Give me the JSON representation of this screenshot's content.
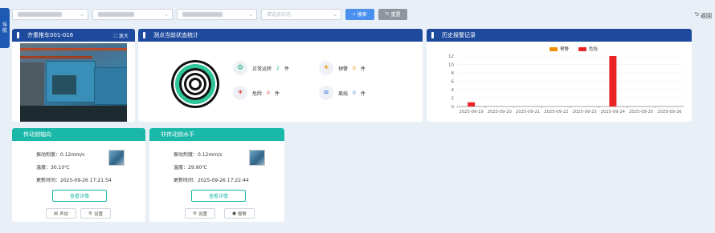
{
  "nav": {
    "label": "导航"
  },
  "filters": {
    "status_placeholder": "请选择状态",
    "search_label": "搜索",
    "reset_label": "重置"
  },
  "back_label": "返回",
  "device": {
    "title": "齐重推车001-016",
    "zoom_label": "放大"
  },
  "status_panel": {
    "title": "测点当前状态统计",
    "items": [
      {
        "label": "正常运转",
        "count": "2",
        "unit": "件"
      },
      {
        "label": "预警",
        "count": "0",
        "unit": "件"
      },
      {
        "label": "危险",
        "count": "0",
        "unit": "件"
      },
      {
        "label": "离线",
        "count": "0",
        "unit": "件"
      }
    ]
  },
  "alarm_panel": {
    "title": "历史报警记录"
  },
  "chart_data": {
    "type": "bar",
    "title": "",
    "categories": [
      "2025-09-19",
      "2025-09-20",
      "2025-09-21",
      "2025-09-22",
      "2025-09-23",
      "2025-09-24",
      "2025-09-25",
      "2025-09-26"
    ],
    "series": [
      {
        "name": "预警",
        "color": "#f08c00",
        "values": [
          0,
          0,
          0,
          0,
          0,
          0,
          0,
          0
        ]
      },
      {
        "name": "危险",
        "color": "#e82424",
        "values": [
          1,
          0,
          0,
          0,
          0,
          12,
          0,
          0
        ]
      }
    ],
    "ylim": [
      0,
      12
    ],
    "yticks": [
      "0",
      "2",
      "4",
      "6",
      "8",
      "10",
      "12"
    ],
    "legend": "top-center"
  },
  "cards": [
    {
      "title": "传动侧轴向",
      "vibration": "振动烈度：0.12mm/s",
      "temperature": "温度：30.10℃",
      "updated": "更新时间：2025-09-26 17:21:54",
      "detail_label": "查看详情",
      "btn1_label": "声纹",
      "btn2_label": "设置"
    },
    {
      "title": "非传动侧水平",
      "vibration": "振动烈度：0.12mm/s",
      "temperature": "温度：29.90℃",
      "updated": "更新时间：2025-09-26 17:22:44",
      "detail_label": "查看详情",
      "btn1_label": "设置",
      "btn2_label": "报警"
    }
  ]
}
